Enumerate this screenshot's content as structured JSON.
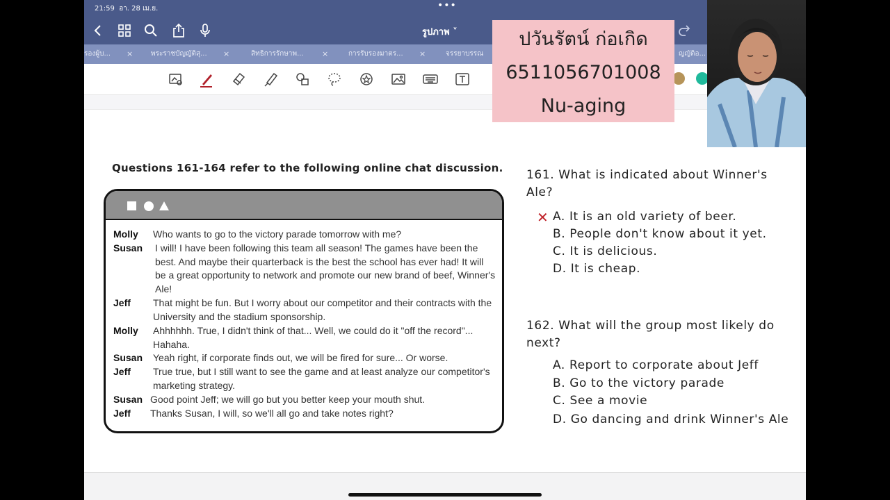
{
  "status": {
    "time": "21:59",
    "date": "อา. 28 เม.ย.",
    "dots": "•••"
  },
  "nav": {
    "title": "รูปภาพ ˅"
  },
  "tabs": [
    {
      "label": "รองผู้บ..."
    },
    {
      "label": "พระราชบัญญัติสุ..."
    },
    {
      "label": "สิทธิการรักษาพ..."
    },
    {
      "label": "การรับรองมาตร..."
    },
    {
      "label": "จรรยาบรรณ"
    },
    {
      "label": "ญญัติอ..."
    }
  ],
  "tab_close": "×",
  "sticky_note": {
    "line1": "ปวันรัตน์ ก่อเกิด",
    "line2": "6511056701008",
    "line3": "Nu-aging"
  },
  "document": {
    "heading": "Questions 161-164 refer to the following online chat discussion.",
    "chat": [
      {
        "who": "Molly",
        "text": "Who wants to go to the victory parade tomorrow with me?"
      },
      {
        "who": "Susan",
        "text": "I will! I have been following this team all season! The games have been the best. And maybe their quarterback is the best the school has ever had! It will be a great opportunity to network and promote our new brand of beef, Winner's Ale!"
      },
      {
        "who": "Jeff",
        "text": "That might be fun. But I worry about our competitor and their contracts with the University and the stadium sponsorship."
      },
      {
        "who": "Molly",
        "text": "Ahhhhhh. True, I didn't think of that... Well, we could do it \"off the record\"... Hahaha."
      },
      {
        "who": "Susan",
        "text": "Yeah right, if corporate finds out, we will be fired for sure... Or worse."
      },
      {
        "who": "Jeff",
        "text": "True true, but I still want to see the game and at least analyze our competitor's marketing strategy."
      },
      {
        "who": "Susan",
        "text": "Good point Jeff; we will go but you better keep your mouth shut."
      },
      {
        "who": "Jeff",
        "text": "Thanks Susan, I will, so we'll all go and take notes right?"
      }
    ],
    "q161": {
      "question": "161. What is indicated about Winner's Ale?",
      "options": [
        "A. It is an old variety of beer.",
        "B. People don't know about it yet.",
        "C. It is delicious.",
        "D. It is cheap."
      ],
      "marked": "✕"
    },
    "q162": {
      "question": "162. What will the group most likely do next?",
      "options": [
        "A. Report to corporate about Jeff",
        "B. Go to the victory parade",
        "C. See a movie",
        "D. Go dancing and drink Winner's Ale"
      ]
    }
  },
  "colors": {
    "navbar": "#4a5a8a",
    "tabsbar": "#8191be",
    "sticky": "#f5c3c8",
    "mark": "#c0242b",
    "pen": "#b0202a"
  },
  "icons": [
    "back-icon",
    "grid-icon",
    "search-icon",
    "share-icon",
    "mic-icon",
    "redo-icon",
    "lasso-image-icon",
    "pen-icon",
    "eraser-icon",
    "highlighter-icon",
    "shapes-icon",
    "lasso-icon",
    "sticker-icon",
    "image-icon",
    "keyboard-icon",
    "text-box-icon"
  ]
}
